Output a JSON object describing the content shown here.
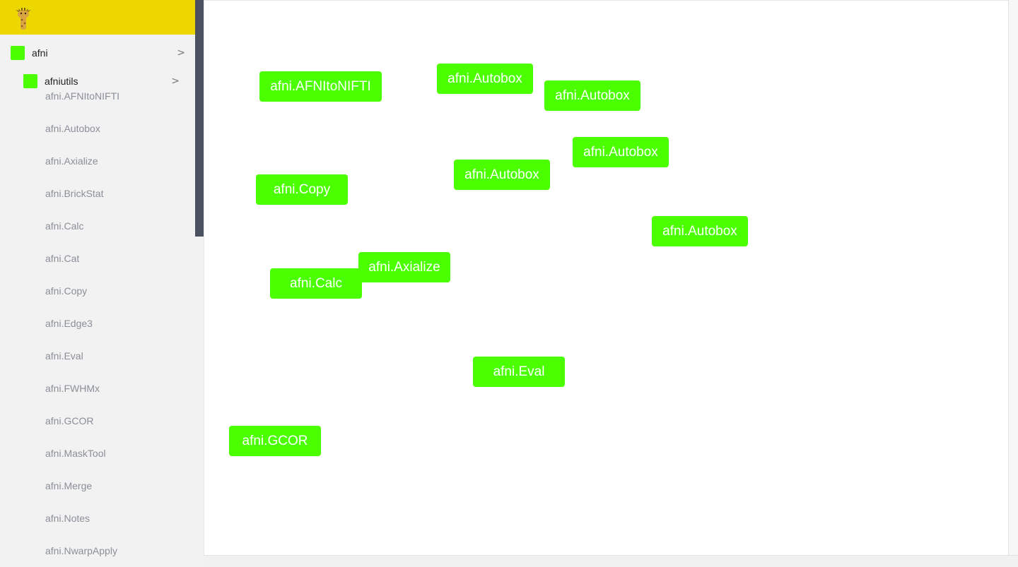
{
  "colors": {
    "header": "#ecd800",
    "node": "#4cff00",
    "sidebar_bg": "#f2f2f2",
    "scroll_thumb": "#4a5160",
    "leaf_text": "#8a8f98"
  },
  "sidebar": {
    "logo_icon": "giraffe-logo",
    "package": {
      "label": "afni",
      "chevron": ">"
    },
    "module": {
      "label": "afniutils",
      "chevron": ">"
    },
    "items": [
      "afni.AFNItoNIFTI",
      "afni.Autobox",
      "afni.Axialize",
      "afni.BrickStat",
      "afni.Calc",
      "afni.Cat",
      "afni.Copy",
      "afni.Edge3",
      "afni.Eval",
      "afni.FWHMx",
      "afni.GCOR",
      "afni.MaskTool",
      "afni.Merge",
      "afni.Notes",
      "afni.NwarpApply"
    ]
  },
  "canvas": {
    "nodes": [
      {
        "id": "n0",
        "label": "afni.AFNItoNIFTI"
      },
      {
        "id": "n1",
        "label": "afni.Autobox"
      },
      {
        "id": "n2",
        "label": "afni.Autobox"
      },
      {
        "id": "n3",
        "label": "afni.Autobox"
      },
      {
        "id": "n4",
        "label": "afni.Copy"
      },
      {
        "id": "n5",
        "label": "afni.Autobox"
      },
      {
        "id": "n6",
        "label": "afni.Autobox"
      },
      {
        "id": "n7",
        "label": "afni.Axialize"
      },
      {
        "id": "n8",
        "label": "afni.Calc"
      },
      {
        "id": "n9",
        "label": "afni.Eval"
      },
      {
        "id": "n10",
        "label": "afni.GCOR"
      }
    ]
  }
}
